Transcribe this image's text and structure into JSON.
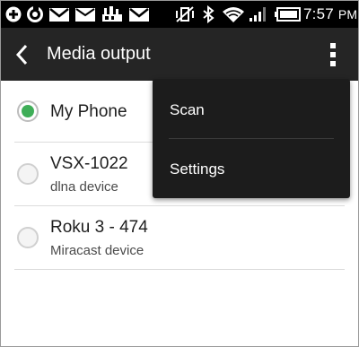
{
  "status_bar": {
    "time": "7:57",
    "time_suffix": "PM",
    "left_icons": [
      "add-icon",
      "sync-icon",
      "gmail-icon",
      "mail-icon",
      "lte-icon",
      "gmail-icon-2"
    ],
    "right_icons": [
      "vibrate-off-icon",
      "bluetooth-icon",
      "wifi-icon",
      "cell-signal-icon",
      "battery-icon"
    ]
  },
  "action_bar": {
    "title": "Media output"
  },
  "devices": [
    {
      "name": "My Phone",
      "subtitle": "",
      "selected": true
    },
    {
      "name": "VSX-1022",
      "subtitle": "dlna device",
      "selected": false
    },
    {
      "name": "Roku 3 - 474",
      "subtitle": "Miracast device",
      "selected": false
    }
  ],
  "menu": {
    "items": [
      {
        "label": "Scan"
      },
      {
        "label": "Settings"
      }
    ]
  },
  "colors": {
    "status_bar": "#000000",
    "action_bar": "#252525",
    "menu_background": "#1c1c1c",
    "radio_selected": "#3fae58"
  }
}
